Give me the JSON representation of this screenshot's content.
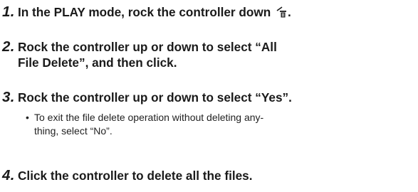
{
  "steps": [
    {
      "number": "1.",
      "text": "In the PLAY mode, rock the controller down",
      "end": "."
    },
    {
      "number": "2.",
      "line1": "Rock the controller up or down to select “All",
      "line2": "File Delete”, and then click."
    },
    {
      "number": "3.",
      "text": "Rock the controller up or down to select “Yes”."
    },
    {
      "number": "4.",
      "text": "Click the controller to delete all the files."
    }
  ],
  "bullet": {
    "symbol": "•",
    "line1": "To exit the file delete operation without deleting any-",
    "line2": "thing, select “No”."
  },
  "icons": {
    "trash": "trash-delete-icon"
  }
}
